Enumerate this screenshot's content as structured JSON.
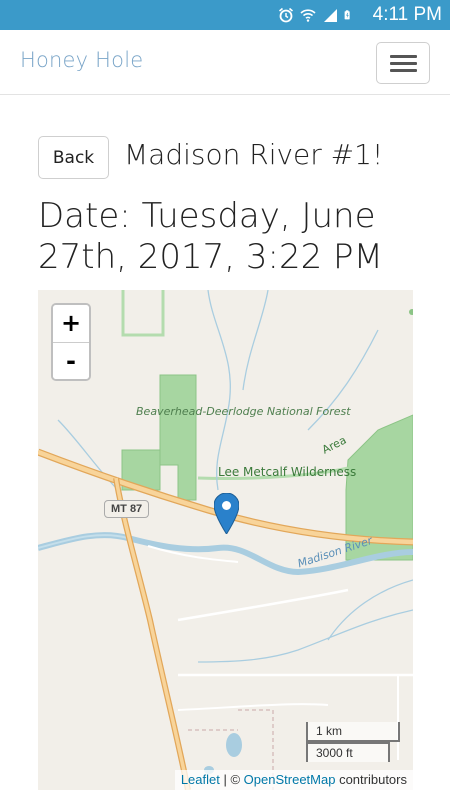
{
  "status_bar": {
    "time": "4:11 PM",
    "icons": [
      "alarm-icon",
      "wifi-icon",
      "signal-icon",
      "battery-charging-icon"
    ]
  },
  "navbar": {
    "brand": "Honey Hole",
    "menu_icon": "hamburger-icon"
  },
  "header": {
    "back_label": "Back",
    "title": "Madison River #1!",
    "date": "Date: Tuesday, June 27th, 2017, 3:22 PM"
  },
  "map": {
    "zoom_in_label": "+",
    "zoom_out_label": "-",
    "labels": {
      "forest": "Beaverhead-Deerlodge National Forest",
      "wilderness": "Lee Metcalf Wilderness",
      "area": "Area",
      "river": "Madison River",
      "highway": "MT 87"
    },
    "scale": {
      "metric": "1 km",
      "imperial": "3000 ft"
    },
    "attribution": {
      "leaflet": "Leaflet",
      "separator": " | © ",
      "osm": "OpenStreetMap",
      "suffix": " contributors"
    },
    "marker_icon": "map-pin-icon",
    "colors": {
      "land": "#f2efe9",
      "forest": "#8fc98f",
      "water": "#a9cde0",
      "road": "#f5c27a",
      "marker": "#2a81cb"
    }
  }
}
